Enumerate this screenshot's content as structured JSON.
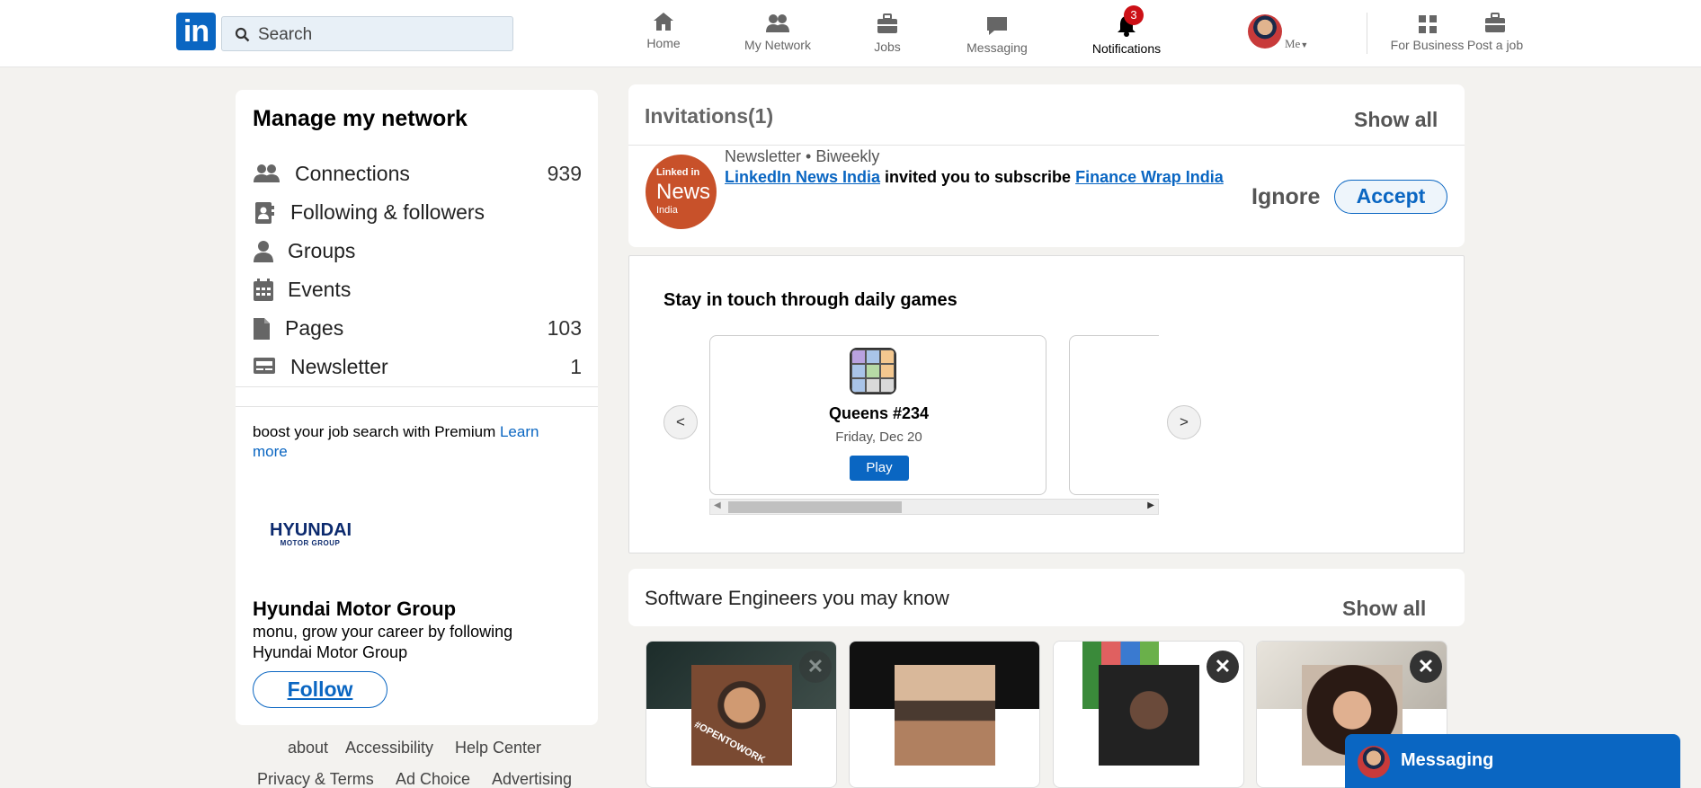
{
  "nav": {
    "search_placeholder": "Search",
    "items": [
      {
        "label": "Home",
        "icon": "home-icon"
      },
      {
        "label": "My Network",
        "icon": "network-icon"
      },
      {
        "label": "Jobs",
        "icon": "briefcase-icon"
      },
      {
        "label": "Messaging",
        "icon": "chat-icon"
      },
      {
        "label": "Notifications",
        "icon": "bell-icon"
      }
    ],
    "notification_count": "3",
    "me_label": "Me",
    "business_label": "For Business",
    "post_job_label": "Post a job"
  },
  "sidebar": {
    "title": "Manage my network",
    "items": [
      {
        "label": "Connections",
        "count": "939",
        "icon": "people-icon"
      },
      {
        "label": "Following & followers",
        "count": "",
        "icon": "contact-card-icon"
      },
      {
        "label": "Groups",
        "count": "",
        "icon": "person-icon"
      },
      {
        "label": "Events",
        "count": "",
        "icon": "calendar-icon"
      },
      {
        "label": "Pages",
        "count": "103",
        "icon": "page-icon"
      },
      {
        "label": "Newsletter",
        "count": "1",
        "icon": "newsletter-icon"
      }
    ]
  },
  "premium": {
    "text": "boost your job search with Premium ",
    "link": "Learn more"
  },
  "ad": {
    "logo_main": "HYUNDAI",
    "logo_sub": "MOTOR GROUP",
    "company": "Hyundai Motor Group",
    "description": "monu, grow your career by following Hyundai Motor Group",
    "follow_label": "Follow"
  },
  "footer": {
    "links_row1": [
      "about",
      "Accessibility",
      "Help Center"
    ],
    "links_row2": [
      "Privacy & Terms",
      "Ad Choice",
      "Advertising"
    ]
  },
  "invitations": {
    "title": "Invitations(1)",
    "show_all": "Show all",
    "logo_line1": "Linked in",
    "logo_line2": "News",
    "logo_line3": "India",
    "subtitle": "Newsletter • Biweekly",
    "sender": "LinkedIn News India",
    "message": " invited you to subscribe ",
    "newsletter": "Finance Wrap India",
    "ignore_label": "Ignore",
    "accept_label": "Accept"
  },
  "games": {
    "title": "Stay in touch through daily games",
    "game_name": "Queens #234",
    "game_date": "Friday, Dec 20",
    "play_label": "Play",
    "prev_label": "<",
    "next_label": ">",
    "queens_colors": [
      "#b9a2e0",
      "#a9c4e8",
      "#f3c78f",
      "#a9c4e8",
      "#b6d9a5",
      "#f3c78f",
      "#a9c4e8",
      "#d9d9d9",
      "#d9d9d9"
    ]
  },
  "people": {
    "title": "Software Engineers you may know",
    "show_all": "Show all",
    "photo_caption_1": "#OPENTOWORK"
  },
  "messaging": {
    "label": "Messaging"
  },
  "colors": {
    "brand": "#0a66c2",
    "badge": "#cc1016",
    "background": "#f3f2ef"
  }
}
